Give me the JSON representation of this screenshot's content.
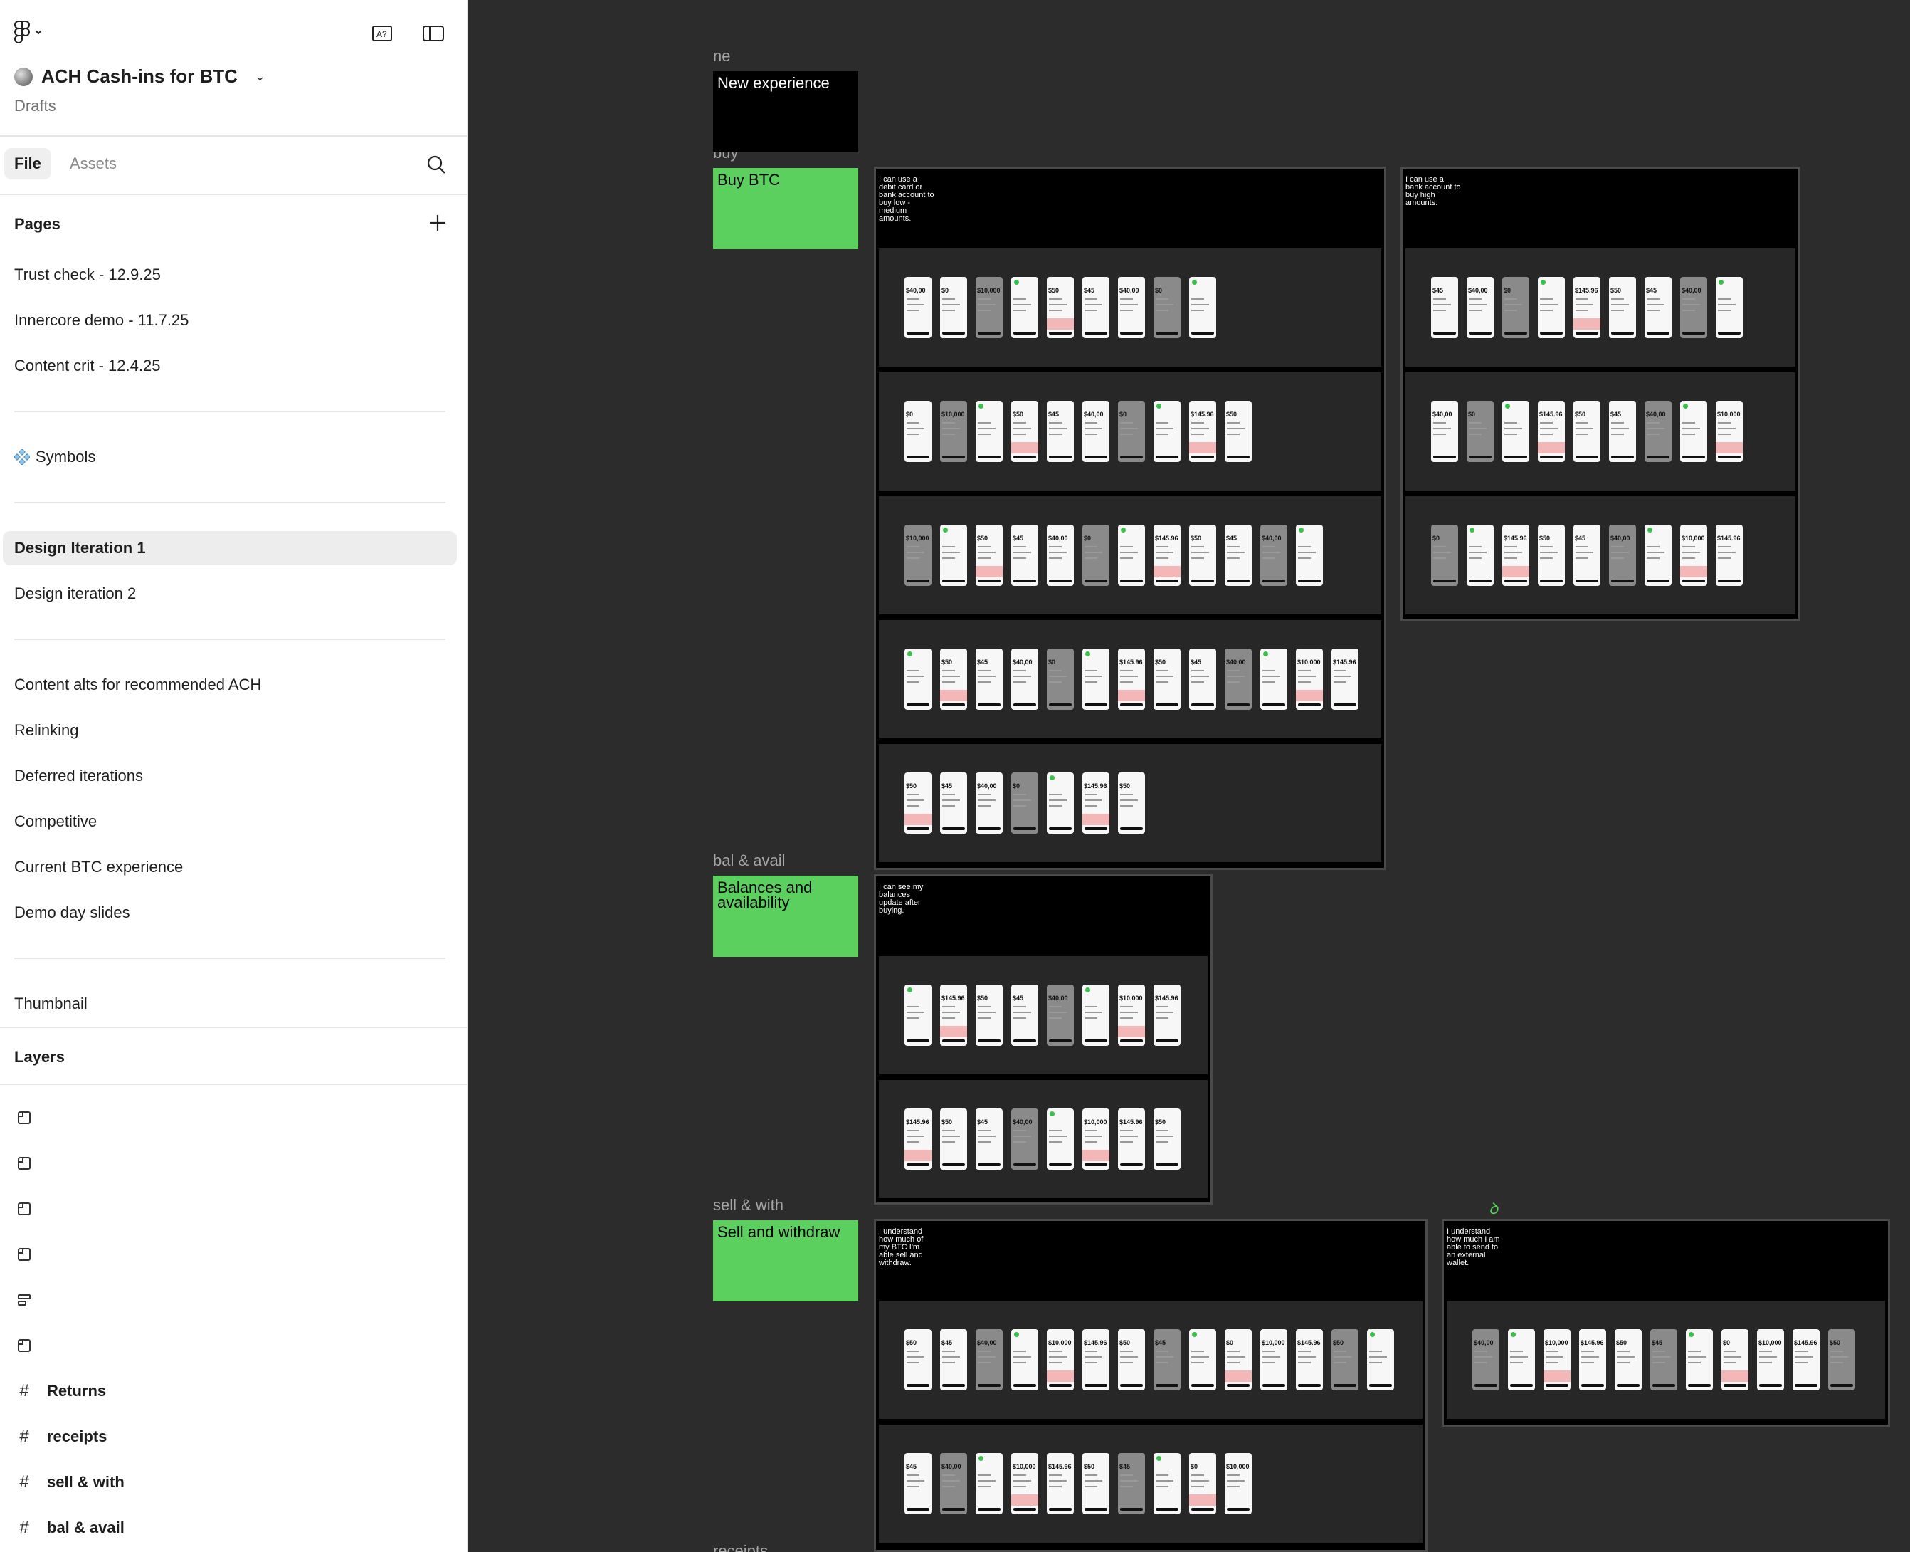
{
  "app": {
    "file_title": "ACH Cash-ins for BTC",
    "location": "Drafts",
    "icons": [
      "figma-logo-icon",
      "chevron-down-icon",
      "ai-text-icon",
      "panel-toggle-icon",
      "globe-icon",
      "search-icon",
      "plus-icon",
      "component-icon",
      "frame-icon",
      "text-frame-icon",
      "hash-icon"
    ]
  },
  "tabs": {
    "file": "File",
    "assets": "Assets"
  },
  "pages": {
    "heading": "Pages",
    "group1": [
      "Trust check - 12.9.25",
      "Innercore demo - 11.7.25",
      "Content crit - 12.4.25"
    ],
    "symbols": "Symbols",
    "group2": [
      "Design Iteration 1",
      "Design iteration 2"
    ],
    "selected": "Design Iteration 1",
    "group3": [
      "Content alts for recommended ACH",
      "Relinking",
      "Deferred iterations",
      "Competitive",
      "Current BTC experience",
      "Demo day slides"
    ],
    "thumbnail": "Thumbnail"
  },
  "layers": {
    "heading": "Layers",
    "frames": [
      "Returns",
      "receipts",
      "sell & with",
      "bal & avail"
    ]
  },
  "canvas": {
    "section_labels": {
      "ne": "ne",
      "buy": "buy",
      "bal": "bal & avail",
      "sell": "sell & with",
      "receipts": "receipts"
    },
    "stickers": {
      "new_experience": "New experience",
      "buy_btc": "Buy BTC",
      "balances": "Balances and availability",
      "sell": "Sell and withdraw"
    },
    "boards": {
      "buy_low": "I can use a debit card or bank account to buy low - medium amounts.",
      "buy_high": "I can use a bank account to buy high amounts.",
      "balances": "I can see my balances update after buying.",
      "sell": "I understand how much of my BTC I'm able sell and withdraw.",
      "external": "I understand how much I am able to send to an external wallet."
    },
    "phone_amounts": [
      "$40,00",
      "$0",
      "$10,000",
      "$145.96",
      "$50",
      "$45"
    ]
  },
  "colors": {
    "sticker_green": "#5cd05e",
    "canvas_bg": "#2c2c2c",
    "board_bg": "#000000",
    "row_bg": "#272727",
    "error_pink": "#f4b7b7"
  }
}
